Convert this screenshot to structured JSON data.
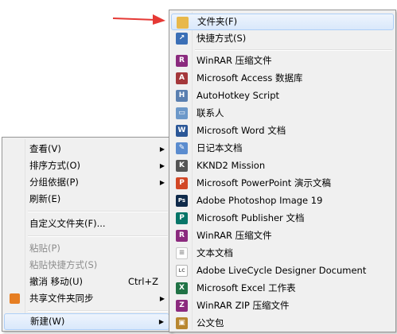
{
  "context_menu": {
    "items": [
      {
        "label": "查看(V)",
        "shortcut": "",
        "submenu": true,
        "disabled": false
      },
      {
        "label": "排序方式(O)",
        "shortcut": "",
        "submenu": true,
        "disabled": false
      },
      {
        "label": "分组依据(P)",
        "shortcut": "",
        "submenu": true,
        "disabled": false
      },
      {
        "label": "刷新(E)",
        "shortcut": "",
        "submenu": false,
        "disabled": false
      },
      {
        "label": "自定义文件夹(F)...",
        "shortcut": "",
        "submenu": false,
        "disabled": false
      },
      {
        "label": "粘贴(P)",
        "shortcut": "",
        "submenu": false,
        "disabled": true
      },
      {
        "label": "粘贴快捷方式(S)",
        "shortcut": "",
        "submenu": false,
        "disabled": true
      },
      {
        "label": "撤消 移动(U)",
        "shortcut": "Ctrl+Z",
        "submenu": false,
        "disabled": false
      },
      {
        "label": "共享文件夹同步",
        "shortcut": "",
        "submenu": true,
        "disabled": false
      },
      {
        "label": "新建(W)",
        "shortcut": "",
        "submenu": true,
        "disabled": false
      }
    ],
    "submenu_arrow": "▶"
  },
  "new_submenu": {
    "items": [
      {
        "label": "文件夹(F)",
        "icon": "folder-icon",
        "color": "#e8b84a",
        "glyph": ""
      },
      {
        "label": "快捷方式(S)",
        "icon": "shortcut-icon",
        "color": "#3b6fb6",
        "glyph": "↗"
      },
      {
        "label": "WinRAR 压缩文件",
        "icon": "winrar-icon",
        "color": "#8b2a7e",
        "glyph": "R"
      },
      {
        "label": "Microsoft Access 数据库",
        "icon": "access-icon",
        "color": "#a4373a",
        "glyph": "A"
      },
      {
        "label": "AutoHotkey Script",
        "icon": "autohotkey-icon",
        "color": "#5a7fb0",
        "glyph": "H"
      },
      {
        "label": "联系人",
        "icon": "contact-icon",
        "color": "#6c98c9",
        "glyph": "▭"
      },
      {
        "label": "Microsoft Word 文档",
        "icon": "word-icon",
        "color": "#2b5797",
        "glyph": "W"
      },
      {
        "label": "日记本文档",
        "icon": "journal-icon",
        "color": "#5b8ccf",
        "glyph": "✎"
      },
      {
        "label": "KKND2 Mission",
        "icon": "kknd2-icon",
        "color": "#555555",
        "glyph": "K"
      },
      {
        "label": "Microsoft PowerPoint 演示文稿",
        "icon": "powerpoint-icon",
        "color": "#d24726",
        "glyph": "P"
      },
      {
        "label": "Adobe Photoshop Image 19",
        "icon": "photoshop-icon",
        "color": "#0f2a4a",
        "glyph": "Ps"
      },
      {
        "label": "Microsoft Publisher 文档",
        "icon": "publisher-icon",
        "color": "#077568",
        "glyph": "P"
      },
      {
        "label": "WinRAR 压缩文件",
        "icon": "winrar-icon",
        "color": "#8b2a7e",
        "glyph": "R"
      },
      {
        "label": "文本文档",
        "icon": "text-document-icon",
        "color": "#c8c8c8",
        "glyph": "≡"
      },
      {
        "label": "Adobe LiveCycle Designer Document",
        "icon": "livecycle-icon",
        "color": "#b5b5b5",
        "glyph": "LC"
      },
      {
        "label": "Microsoft Excel 工作表",
        "icon": "excel-icon",
        "color": "#207245",
        "glyph": "X"
      },
      {
        "label": "WinRAR ZIP 压缩文件",
        "icon": "winrar-zip-icon",
        "color": "#8b2a7e",
        "glyph": "Z"
      },
      {
        "label": "公文包",
        "icon": "briefcase-icon",
        "color": "#b8862f",
        "glyph": "▣"
      }
    ]
  },
  "annotation": {
    "arrow_color": "#e53935"
  }
}
